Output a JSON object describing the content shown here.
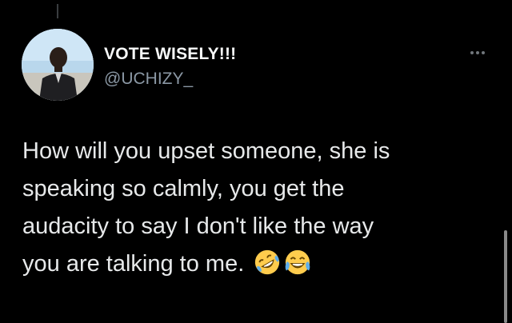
{
  "tweet": {
    "author": {
      "display_name": "VOTE WISELY!!!",
      "handle": "@UCHIZY_",
      "avatar_icon": "profile-photo"
    },
    "text_lines": [
      "How will you upset someone, she is",
      "speaking so calmly, you get the",
      "audacity to say I don't like the way",
      "you are talking to me."
    ],
    "emojis": [
      "rolling-on-floor-laughing-emoji",
      "face-with-tears-of-joy-emoji"
    ],
    "more_icon": "more-options-icon"
  },
  "colors": {
    "background": "#000000",
    "text": "#e7e9ea",
    "secondary": "#8b98a5",
    "link": "#1d9bf0"
  }
}
